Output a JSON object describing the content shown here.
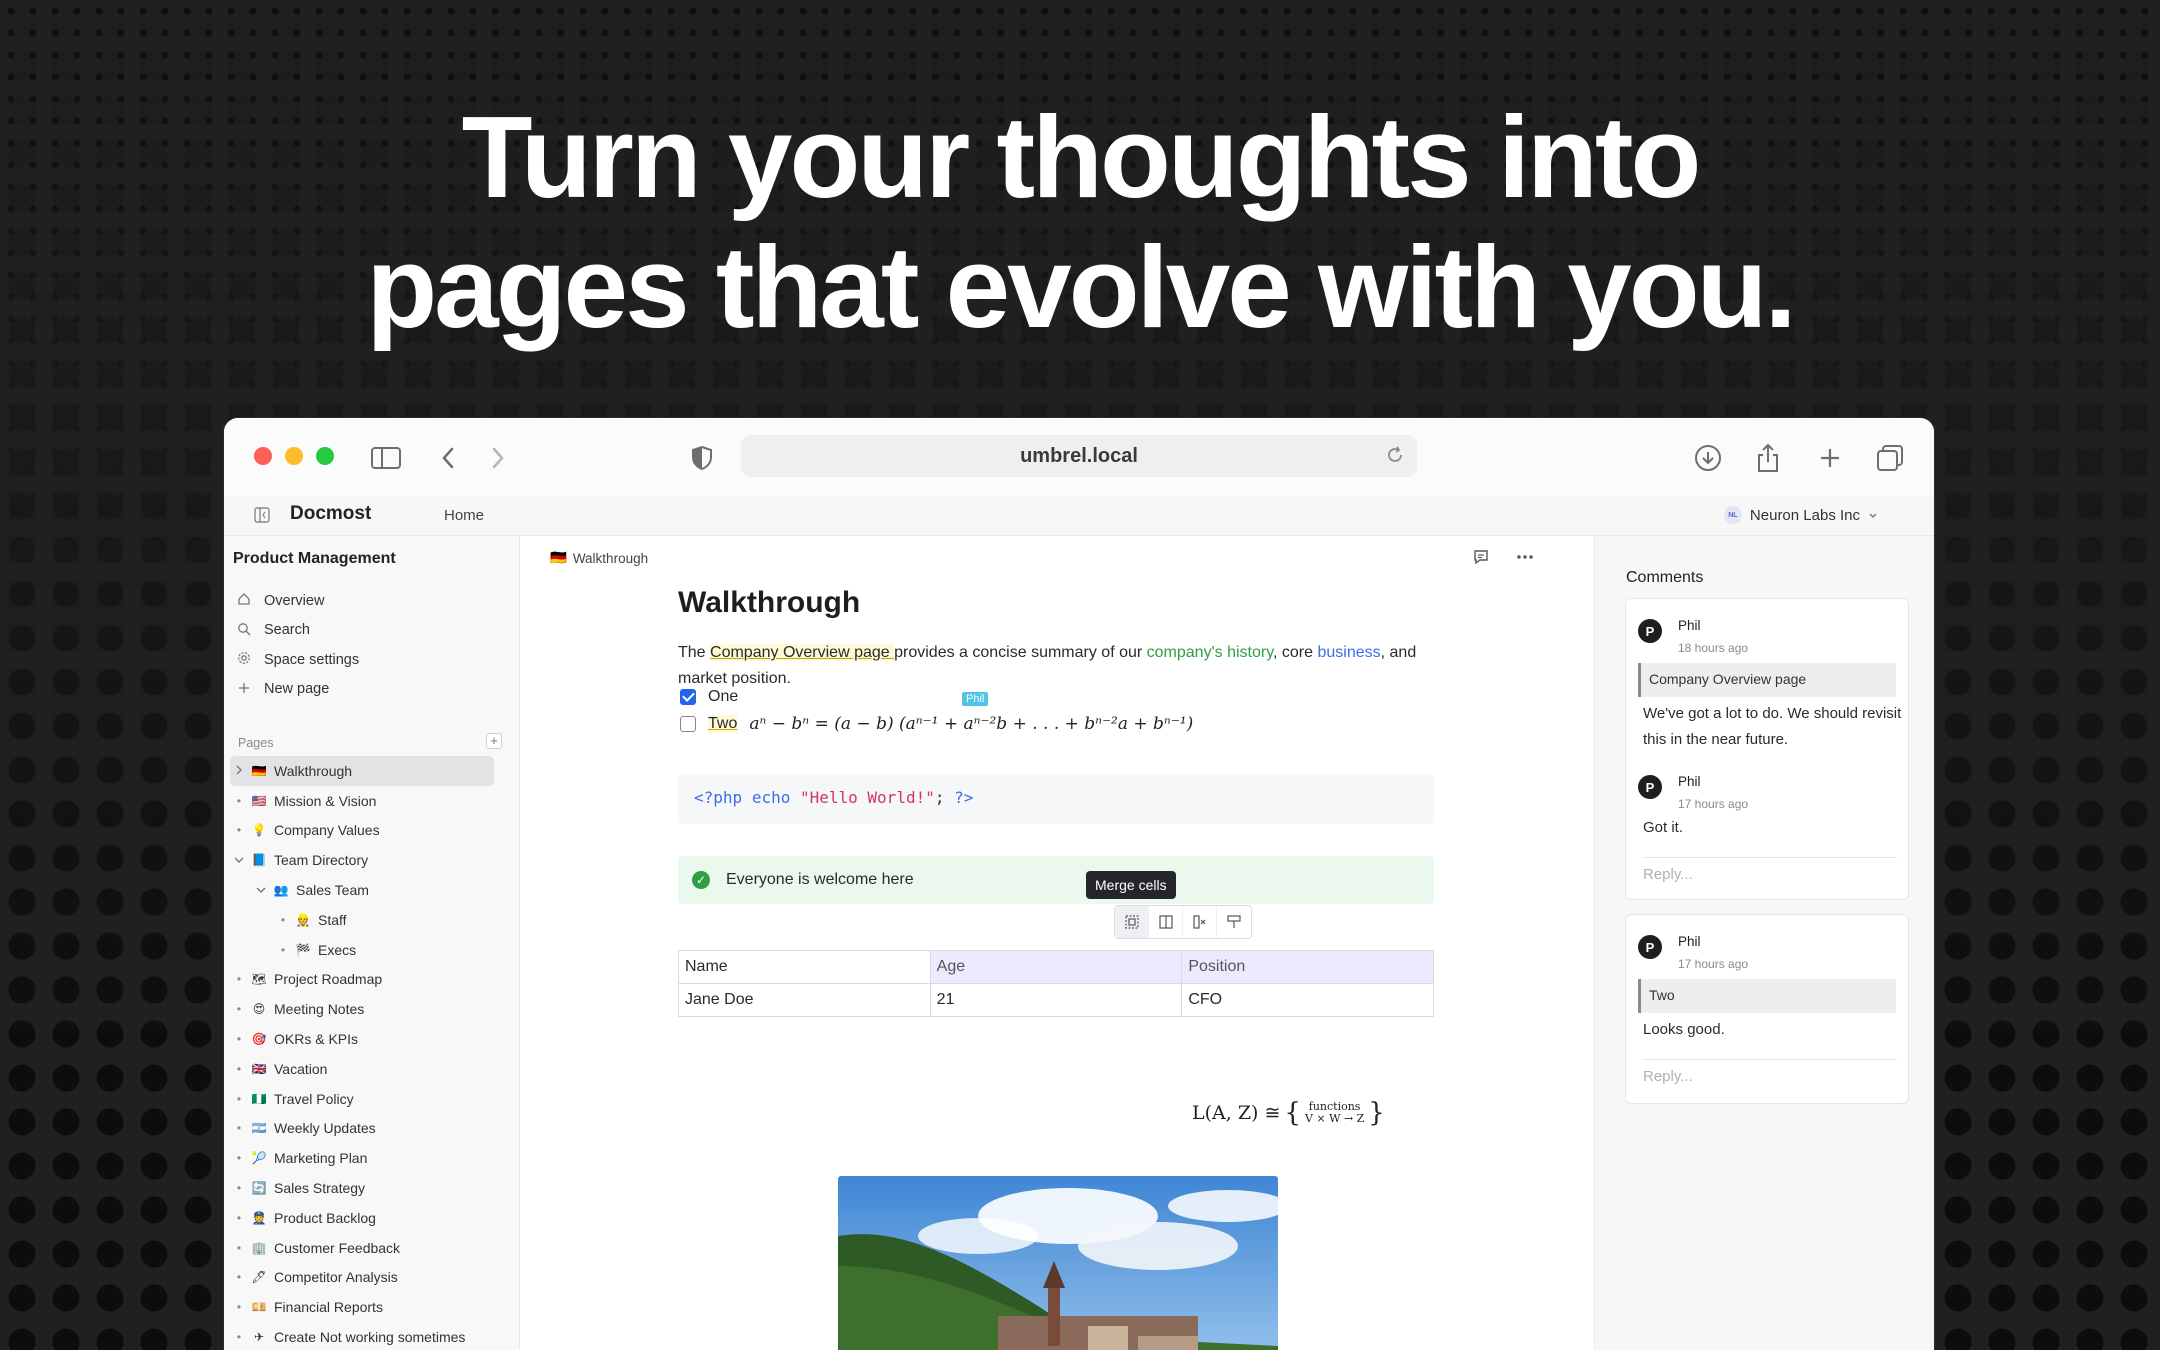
{
  "hero": {
    "line1": "Turn your thoughts into",
    "line2": "pages that evolve with you."
  },
  "browser": {
    "url": "umbrel.local"
  },
  "app": {
    "brand": "Docmost",
    "home_link": "Home",
    "org_initials": "NL",
    "org_name": "Neuron Labs Inc"
  },
  "sidebar": {
    "space_title": "Product Management",
    "nav": [
      {
        "label": "Overview",
        "icon": "home-icon"
      },
      {
        "label": "Search",
        "icon": "search-icon"
      },
      {
        "label": "Space settings",
        "icon": "gear-icon"
      },
      {
        "label": "New page",
        "icon": "plus-icon"
      }
    ],
    "pages_label": "Pages",
    "pages_add": "+",
    "tree": [
      {
        "label": "Walkthrough",
        "emoji": "🇩🇪"
      },
      {
        "label": "Mission & Vision",
        "emoji": "🇺🇸"
      },
      {
        "label": "Company Values",
        "emoji": "💡"
      },
      {
        "label": "Team Directory",
        "emoji": "📘"
      },
      {
        "label": "Sales Team",
        "emoji": "👥"
      },
      {
        "label": "Staff",
        "emoji": "👷"
      },
      {
        "label": "Execs",
        "emoji": "🏁"
      },
      {
        "label": "Project Roadmap",
        "emoji": "🗺"
      },
      {
        "label": "Meeting Notes",
        "emoji": "😍"
      },
      {
        "label": "OKRs & KPIs",
        "emoji": "🎯"
      },
      {
        "label": "Vacation",
        "emoji": "🇬🇧"
      },
      {
        "label": "Travel Policy",
        "emoji": "🇳🇬"
      },
      {
        "label": "Weekly Updates",
        "emoji": "🇦🇷"
      },
      {
        "label": "Marketing Plan",
        "emoji": "🎾"
      },
      {
        "label": "Sales Strategy",
        "emoji": "🔄"
      },
      {
        "label": "Product Backlog",
        "emoji": "👮"
      },
      {
        "label": "Customer Feedback",
        "emoji": "🏢"
      },
      {
        "label": "Competitor Analysis",
        "emoji": "🖊"
      },
      {
        "label": "Financial Reports",
        "emoji": "💴"
      },
      {
        "label": "Create Not working sometimes",
        "emoji": "✈"
      }
    ]
  },
  "editor": {
    "breadcrumb_emoji": "🇩🇪",
    "breadcrumb": "Walkthrough",
    "title": "Walkthrough",
    "para": {
      "t1": "The ",
      "link1": "Company Overview page ",
      "t2": "provides a concise summary of our ",
      "link2": "company's history",
      "t3": ", core ",
      "link3": "business",
      "t4": ", and market position."
    },
    "task1": "One",
    "task2": "Two",
    "cursor_user": "Phil",
    "equation": "aⁿ − bⁿ = (a − b) (aⁿ⁻¹ + aⁿ⁻²b + . . . + bⁿ⁻²a + bⁿ⁻¹)",
    "code": {
      "kw1": "<?php",
      "kw2": "echo",
      "str": "\"Hello World!\"",
      "semi": ";",
      "kw3": "?>"
    },
    "callout": "Everyone is welcome here",
    "tooltip": "Merge cells",
    "table": {
      "headers": [
        "Name",
        "Age",
        "Position"
      ],
      "row": [
        "Jane Doe",
        "21",
        "CFO"
      ]
    },
    "formula": {
      "lhs": "L(A, Z) ≅",
      "num": "functions",
      "den": "V × W → Z"
    }
  },
  "comments": {
    "title": "Comments",
    "threads": [
      {
        "author": "Phil",
        "time": "18 hours ago",
        "quote": "Company Overview page",
        "body": "We've got a lot to do. We should revisit this in the near future.",
        "reply_author": "Phil",
        "reply_time": "17 hours ago",
        "reply_body": "Got it.",
        "reply_placeholder": "Reply..."
      },
      {
        "author": "Phil",
        "time": "17 hours ago",
        "quote": "Two",
        "body": "Looks good.",
        "reply_placeholder": "Reply..."
      }
    ]
  },
  "colors": {
    "accent": "#2563eb",
    "link_green": "#2f9e44",
    "link_blue": "#3b6ee8",
    "callout_bg": "#ebf8ee"
  }
}
